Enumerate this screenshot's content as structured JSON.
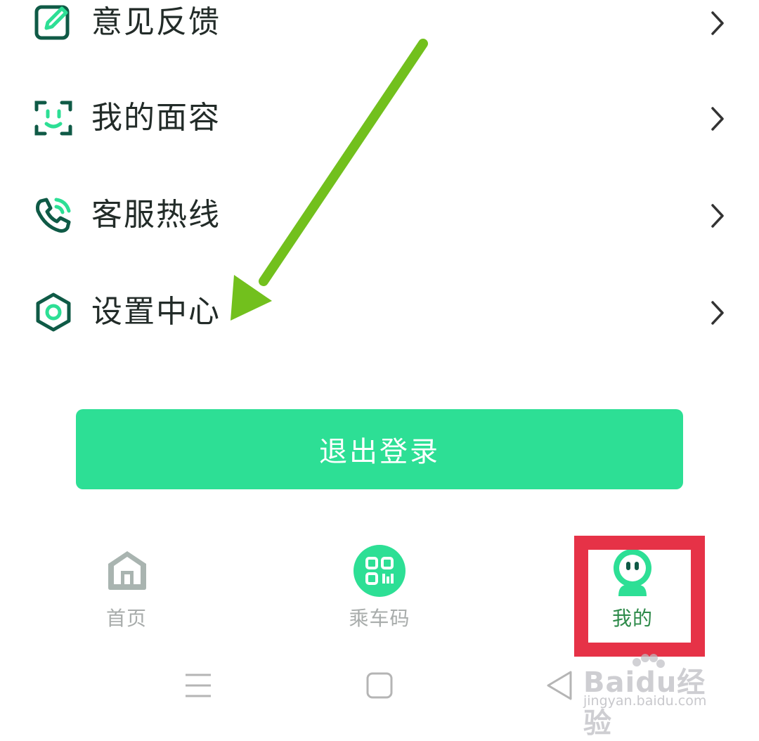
{
  "menu": {
    "items": [
      {
        "label": "意见反馈",
        "icon": "edit-icon"
      },
      {
        "label": "我的面容",
        "icon": "face-scan-icon"
      },
      {
        "label": "客服热线",
        "icon": "phone-icon"
      },
      {
        "label": "设置中心",
        "icon": "settings-hexagon-icon"
      }
    ]
  },
  "logout_button": {
    "label": "退出登录"
  },
  "tabbar": {
    "tabs": [
      {
        "label": "首页",
        "icon": "home-icon",
        "active": false
      },
      {
        "label": "乘车码",
        "icon": "qr-code-icon",
        "active": false
      },
      {
        "label": "我的",
        "icon": "profile-robot-icon",
        "active": true
      }
    ]
  },
  "watermark": {
    "brand": "Baidu经验",
    "url": "jingyan.baidu.com"
  },
  "colors": {
    "accent_green": "#2ddf95",
    "icon_dark_green": "#0f5a46",
    "annotation_arrow": "#72c01d",
    "highlight_box": "#e63247",
    "inactive_tab": "#a8acab"
  }
}
